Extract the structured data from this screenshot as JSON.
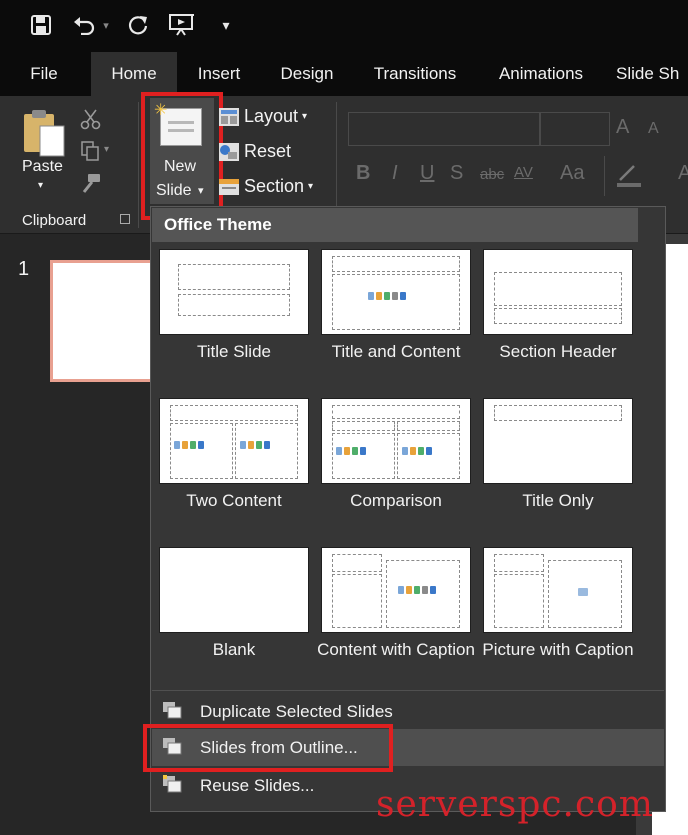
{
  "qat": {
    "save": "save-icon",
    "undo": "undo-icon",
    "redo": "redo-icon",
    "present": "start-from-beginning-icon",
    "customize": "▾"
  },
  "tabs": [
    {
      "label": "File"
    },
    {
      "label": "Home",
      "active": true
    },
    {
      "label": "Insert"
    },
    {
      "label": "Design"
    },
    {
      "label": "Transitions"
    },
    {
      "label": "Animations"
    },
    {
      "label": "Slide Sh"
    }
  ],
  "ribbon": {
    "paste": "Paste",
    "clipboard_group": "Clipboard",
    "new_slide_line1": "New",
    "new_slide_line2": "Slide",
    "layout": "Layout",
    "reset": "Reset",
    "section": "Section",
    "font_size_up": "A",
    "font_size_down": "A",
    "bold": "B",
    "italic": "I",
    "underline": "U",
    "shadow": "S",
    "strikethrough": "abc",
    "spacing": "AV",
    "case": "Aa"
  },
  "slides_pane": {
    "slide_number": "1"
  },
  "menu": {
    "header": "Office Theme",
    "layouts": [
      {
        "name": "Title Slide"
      },
      {
        "name": "Title and Content"
      },
      {
        "name": "Section Header"
      },
      {
        "name": "Two Content"
      },
      {
        "name": "Comparison"
      },
      {
        "name": "Title Only"
      },
      {
        "name": "Blank"
      },
      {
        "name": "Content with Caption"
      },
      {
        "name": "Picture with Caption"
      }
    ],
    "duplicate": "Duplicate Selected Slides",
    "from_outline": "Slides from Outline...",
    "reuse": "Reuse Slides..."
  },
  "watermark": "serverspc.com",
  "colors": {
    "highlight": "#e02020",
    "slide_selected_border": "#e8a090",
    "watermark": "#d4222a"
  }
}
